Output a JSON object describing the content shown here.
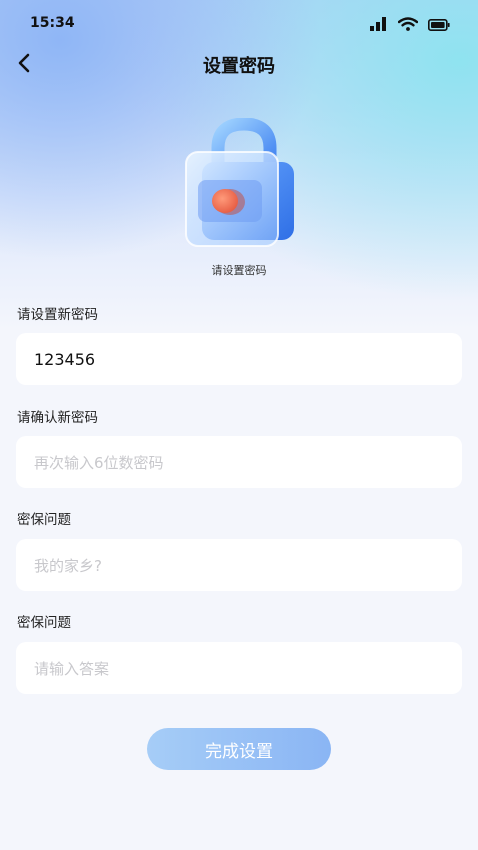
{
  "status_bar": {
    "time": "15:34",
    "icons": [
      "signal-icon",
      "wifi-icon",
      "battery-icon"
    ]
  },
  "header": {
    "back_icon": "back-arrow-icon",
    "title": "设置密码"
  },
  "illustration": {
    "icon": "lock-icon",
    "caption": "请设置密码"
  },
  "form": {
    "new_password": {
      "label": "请设置新密码",
      "value": "123456"
    },
    "confirm_password": {
      "label": "请确认新密码",
      "placeholder": "再次输入6位数密码"
    },
    "security_question": {
      "label": "密保问题",
      "placeholder": "我的家乡?"
    },
    "security_answer": {
      "label": "密保问题",
      "placeholder": "请输入答案"
    }
  },
  "submit": {
    "label": "完成设置"
  },
  "colors": {
    "button_gradient_start": "#a6cdf7",
    "button_gradient_end": "#8ab5f4",
    "page_background": "#f4f6fc",
    "accent_orange": "#f07356"
  }
}
